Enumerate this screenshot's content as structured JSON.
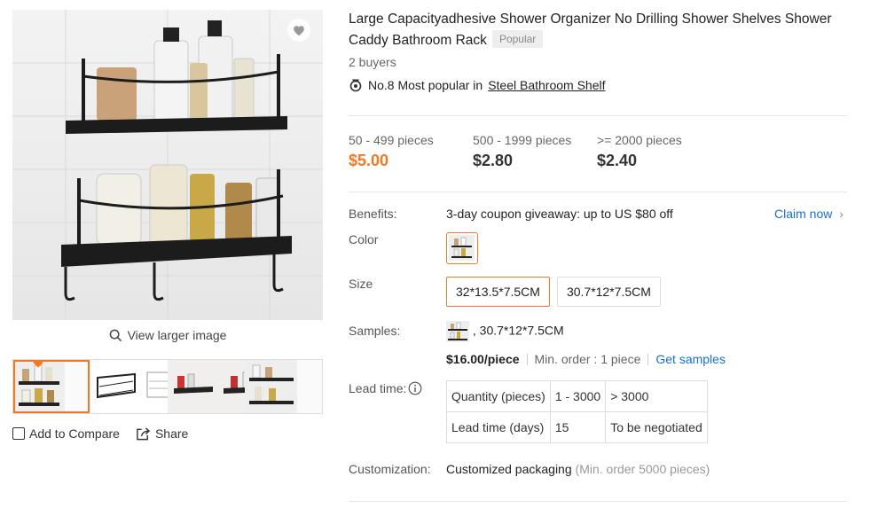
{
  "gallery": {
    "view_larger": "View larger image",
    "add_compare": "Add to Compare",
    "share": "Share"
  },
  "product": {
    "title": "Large Capacityadhesive Shower Organizer No Drilling Shower Shelves Shower Caddy Bathroom Rack",
    "badge": "Popular",
    "buyers": "2 buyers",
    "rank_prefix": "No.8 Most popular in",
    "rank_category": "Steel Bathroom Shelf"
  },
  "price_tiers": [
    {
      "qty": "50 - 499 pieces",
      "price": "$5.00"
    },
    {
      "qty": "500 - 1999 pieces",
      "price": "$2.80"
    },
    {
      "qty": ">= 2000 pieces",
      "price": "$2.40"
    }
  ],
  "benefits": {
    "label": "Benefits:",
    "text": "3-day coupon giveaway: up to US $80 off",
    "claim": "Claim now"
  },
  "color": {
    "label": "Color"
  },
  "size": {
    "label": "Size",
    "options": [
      "32*13.5*7.5CM",
      "30.7*12*7.5CM"
    ]
  },
  "samples": {
    "label": "Samples:",
    "variant": ", 30.7*12*7.5CM",
    "price": "$16.00/piece",
    "min_order": "Min. order : 1 piece",
    "get": "Get samples"
  },
  "lead_time": {
    "label": "Lead time:",
    "rows": [
      [
        "Quantity (pieces)",
        "1 - 3000",
        "> 3000"
      ],
      [
        "Lead time (days)",
        "15",
        "To be negotiated"
      ]
    ]
  },
  "customization": {
    "label": "Customization:",
    "text": "Customized packaging",
    "note": "(Min. order 5000 pieces)"
  },
  "colors": {
    "accent": "#f7771f",
    "link": "#1a6fd0"
  }
}
